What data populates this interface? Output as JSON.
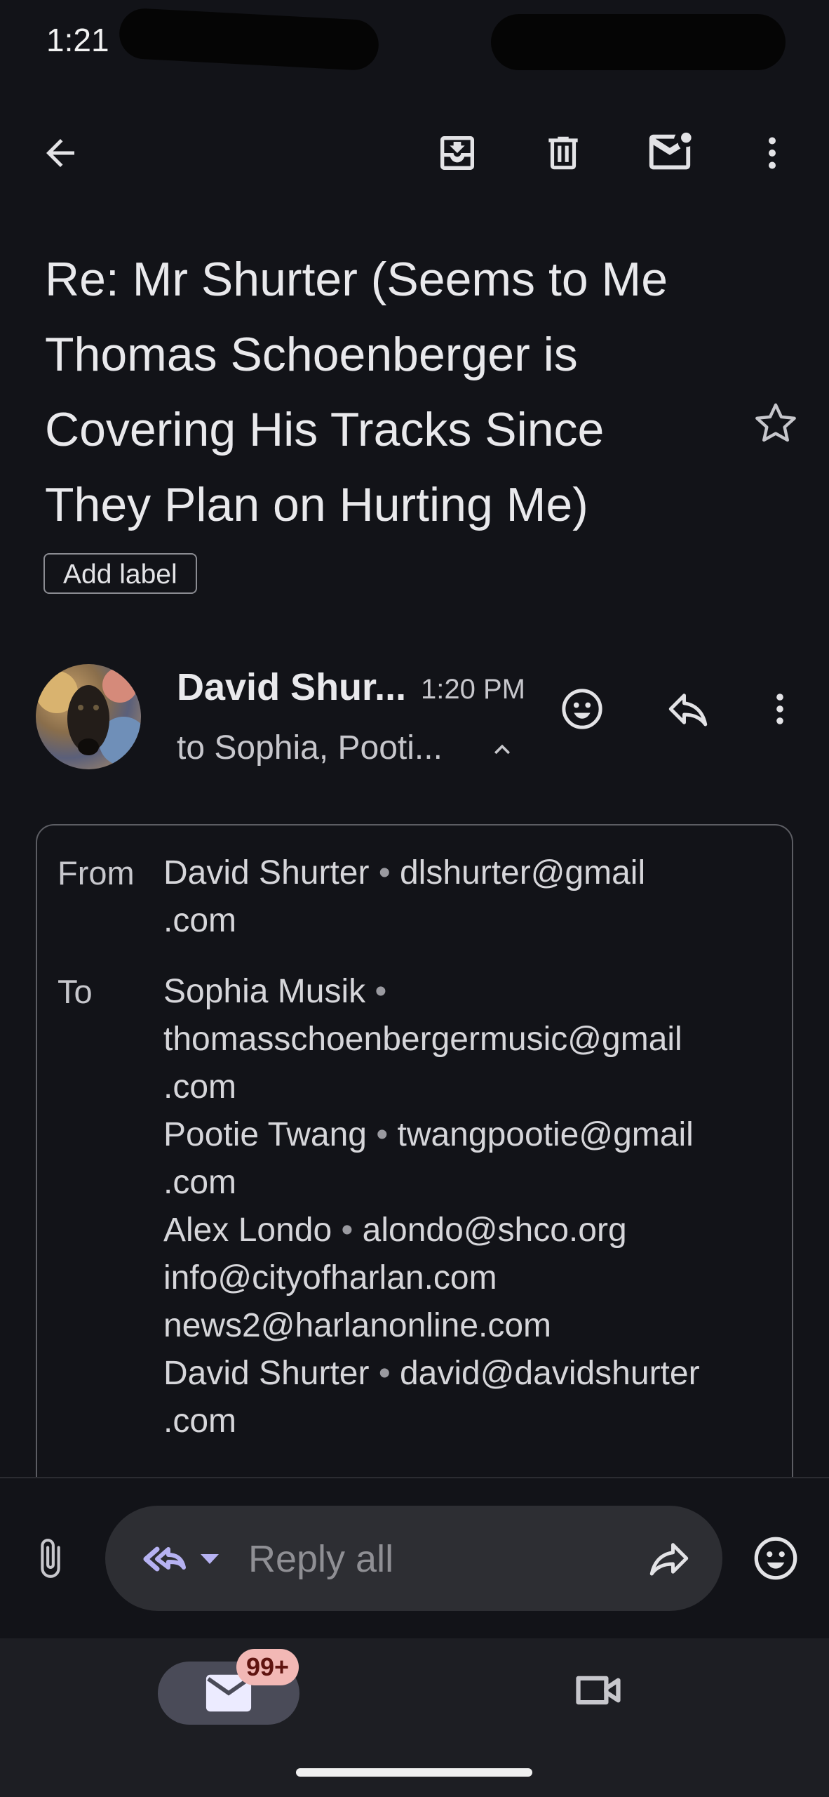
{
  "status_bar": {
    "time": "1:21"
  },
  "subject": "Re: Mr Shurter (Seems to Me Thomas Schoenberger is Covering His Tracks Since They Plan on Hurting Me)",
  "add_label": "Add label",
  "message": {
    "sender": "David Shur...",
    "time": "1:20 PM",
    "to_summary": "to Sophia, Pooti..."
  },
  "details": {
    "from_label": "From",
    "to_label": "To",
    "from_name": "David Shurter",
    "from_email_1": "dlshurter@gmail",
    "from_email_2": ".com",
    "recipients": [
      {
        "name": "Sophia Musik",
        "email_1": "thomasschoenbergermusic@gmail",
        "email_2": ".com"
      },
      {
        "name": "Pootie Twang",
        "email_1": "twangpootie@gmail",
        "email_2": ".com"
      },
      {
        "name": "Alex Londo",
        "email_1": "alondo@shco.org"
      },
      {
        "email_1": "info@cityofharlan.com"
      },
      {
        "email_1": "news2@harlanonline.com"
      },
      {
        "name": "David Shurter",
        "email_1": "david@davidshurter",
        "email_2": ".com"
      }
    ]
  },
  "compose": {
    "reply_placeholder": "Reply all"
  },
  "nav": {
    "mail_badge": "99+"
  },
  "icons": {
    "back": "back-arrow-icon",
    "archive": "archive-icon",
    "delete": "trash-icon",
    "unread": "mark-unread-icon",
    "more": "more-vert-icon",
    "star": "star-icon",
    "emoji": "emoji-icon",
    "reply": "reply-icon",
    "attach": "attach-icon",
    "reply_all": "reply-all-icon",
    "forward": "forward-icon",
    "mail": "mail-icon",
    "meet": "video-icon"
  }
}
